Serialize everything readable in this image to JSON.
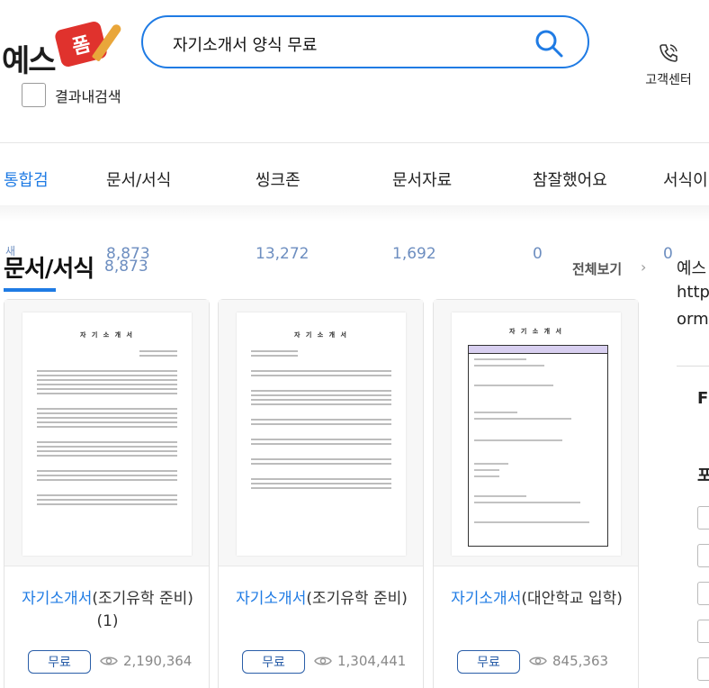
{
  "brand": {
    "logo_text": "예스",
    "logo_stamp": "폼"
  },
  "search": {
    "query": "자기소개서 양식 무료"
  },
  "header": {
    "customer_center": "고객센터",
    "within_results": "결과내검색"
  },
  "tabs": [
    {
      "label": "통합검",
      "count": "새"
    },
    {
      "label": "문서/서식",
      "count": "8,873"
    },
    {
      "label": "씽크존",
      "count": "13,272"
    },
    {
      "label": "문서자료",
      "count": "1,692"
    },
    {
      "label": "참잘했어요",
      "count": "0"
    },
    {
      "label": "서식이",
      "count": "0"
    }
  ],
  "section": {
    "title": "문서/서식",
    "count": "8,873",
    "view_all": "전체보기",
    "arrow": "›"
  },
  "sidebar": {
    "line1": "예스",
    "line2": "http",
    "line3": "orm",
    "head1": "F",
    "head2": "포"
  },
  "cards": [
    {
      "thumb_title": "자 기 소 개 서",
      "keyword": "자기소개서",
      "title_rest": "(조기유학 준비)(1)",
      "badge": "무료",
      "views": "2,190,364"
    },
    {
      "thumb_title": "자 기 소 개 서",
      "keyword": "자기소개서",
      "title_rest": "(조기유학 준비)",
      "badge": "무료",
      "views": "1,304,441"
    },
    {
      "thumb_title": "자 기 소 개 서",
      "keyword": "자기소개서",
      "title_rest": "(대안학교 입학)",
      "badge": "무료",
      "views": "845,363"
    }
  ],
  "colors": {
    "accent": "#1f7be4",
    "count_blue": "#6d8ec0",
    "badge_border": "#2a5ea8",
    "logo_red": "#e0322d"
  }
}
